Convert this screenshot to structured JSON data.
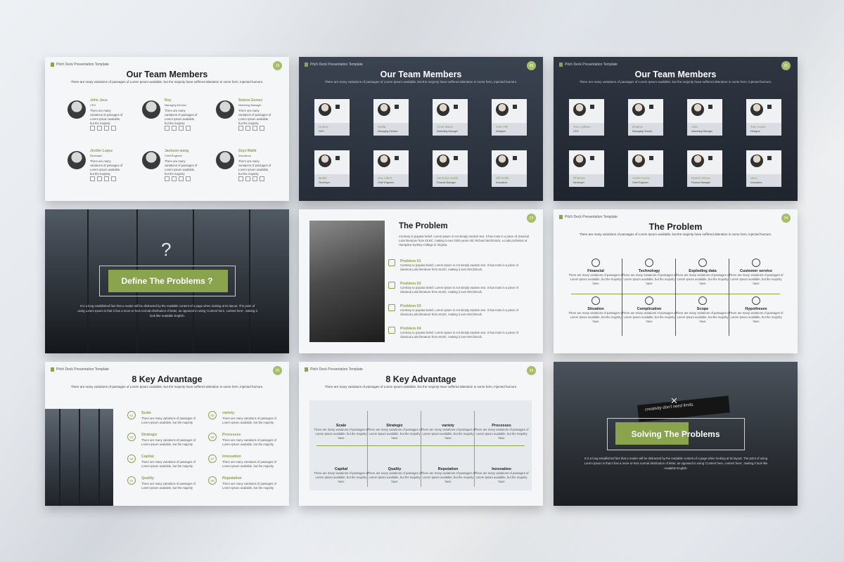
{
  "brand": "Pitch Deck Presentation Template",
  "lorem_sub": "There are many variations of passages of Lorem Ipsum available, but the majority have suffered alteration in some form, injected humors.",
  "short_desc": "There are many variations of passages of Lorem Ipsum available, but the majority",
  "slides": {
    "team_light": {
      "num": "19",
      "title": "Our Team Members",
      "members": [
        {
          "name": "John Jeus",
          "role": "CEO"
        },
        {
          "name": "Roy",
          "role": "Managing Director"
        },
        {
          "name": "Selena Gomez",
          "role": "Marketing Manager"
        },
        {
          "name": "Jenifer Lopez",
          "role": "Developer"
        },
        {
          "name": "Jackson wang",
          "role": "Chief Engineer"
        },
        {
          "name": "Zayn Malik",
          "role": "Innovators"
        }
      ]
    },
    "team_dark1": {
      "num": "20",
      "title": "Our Team Members",
      "members": [
        {
          "name": "Hubert",
          "role": "CEO"
        },
        {
          "name": "Stella",
          "role": "Managing Director"
        },
        {
          "name": "Anne Marie",
          "role": "Marketing Manager"
        },
        {
          "name": "John Hill",
          "role": "Designer"
        },
        {
          "name": "Butler",
          "role": "Developer"
        },
        {
          "name": "Zoe Albert",
          "role": "Chief Engineer"
        },
        {
          "name": "Veronica Smith",
          "role": "Finance Manager"
        },
        {
          "name": "Elli Smith",
          "role": "Innovators"
        }
      ]
    },
    "team_dark2": {
      "num": "21",
      "title": "Our Team Members",
      "members": [
        {
          "name": "Tom Latham",
          "role": "CEO"
        },
        {
          "name": "Dhakra",
          "role": "Managing Director"
        },
        {
          "name": "Aldo",
          "role": "Marketing Manager"
        },
        {
          "name": "Tom Curtis",
          "role": "Designer"
        },
        {
          "name": "Rhianna",
          "role": "Developer"
        },
        {
          "name": "Andre Ferris",
          "role": "Chief Engineer"
        },
        {
          "name": "Daniel Vetory",
          "role": "Finance Manager"
        },
        {
          "name": "Vera",
          "role": "Innovators"
        }
      ]
    },
    "define": {
      "title": "Define The Problems ?",
      "body": "It is a long established fact that a reader will be distracted by the readable content of a page when looking at its layout. The point of using Lorem Ipsum is that it has a more-or-less normal distribution of letter, as opposed to using 'Content here, content here', making it look like readable English."
    },
    "problem_photo": {
      "num": "23",
      "title": "The Problem",
      "intro": "Contrary to popular belief, Lorem Ipsum is not simply random text. It has roots in a piece of classical Latin literature from 45 BC, making it over 2000 years old. Richard McClintock, a Latin professor at Hampden-Sydney College in Virginia.",
      "item_desc": "Contrary to popular belief, Lorem Ipsum is not simply random text. It has roots in a piece of classical Latin literature from 45 BC, making it over McClintock.",
      "items": [
        "Problem 01",
        "Problem 02",
        "Problem 03",
        "Problem 04"
      ]
    },
    "problem_grid": {
      "num": "24",
      "title": "The Problem",
      "cell_desc": "There are many variations of passages of Lorem Ipsum available, but the majority have",
      "cells": [
        "Financial",
        "Technology",
        "Exploding data",
        "Customer service",
        "Situation",
        "Complication",
        "Scope",
        "Hypotheses"
      ]
    },
    "advantage1": {
      "num": "25",
      "title": "8 Key Advantage",
      "items": [
        {
          "n": "01",
          "h": "Scale"
        },
        {
          "n": "02",
          "h": "Strategic"
        },
        {
          "n": "03",
          "h": "Capital"
        },
        {
          "n": "04",
          "h": "Quality"
        },
        {
          "n": "05",
          "h": "variety"
        },
        {
          "n": "06",
          "h": "Processes"
        },
        {
          "n": "07",
          "h": "Innovation"
        },
        {
          "n": "08",
          "h": "Reputation"
        }
      ]
    },
    "advantage2": {
      "num": "26",
      "title": "8 Key Advantage",
      "cells": [
        "Scale",
        "Strategic",
        "variety",
        "Processes",
        "Capital",
        "Quality",
        "Reputation",
        "Innovation"
      ]
    },
    "solving": {
      "title": "Solving The Problems",
      "card_text": "creativity don't need limits.",
      "body": "It is a long established fact that a reader will be distracted by the readable content of a page when looking at its layout. The point of using Lorem Ipsum is that it has a more-or-less normal distribution of letter, as opposed to using 'Content here, content here', making it look like readable English."
    }
  }
}
